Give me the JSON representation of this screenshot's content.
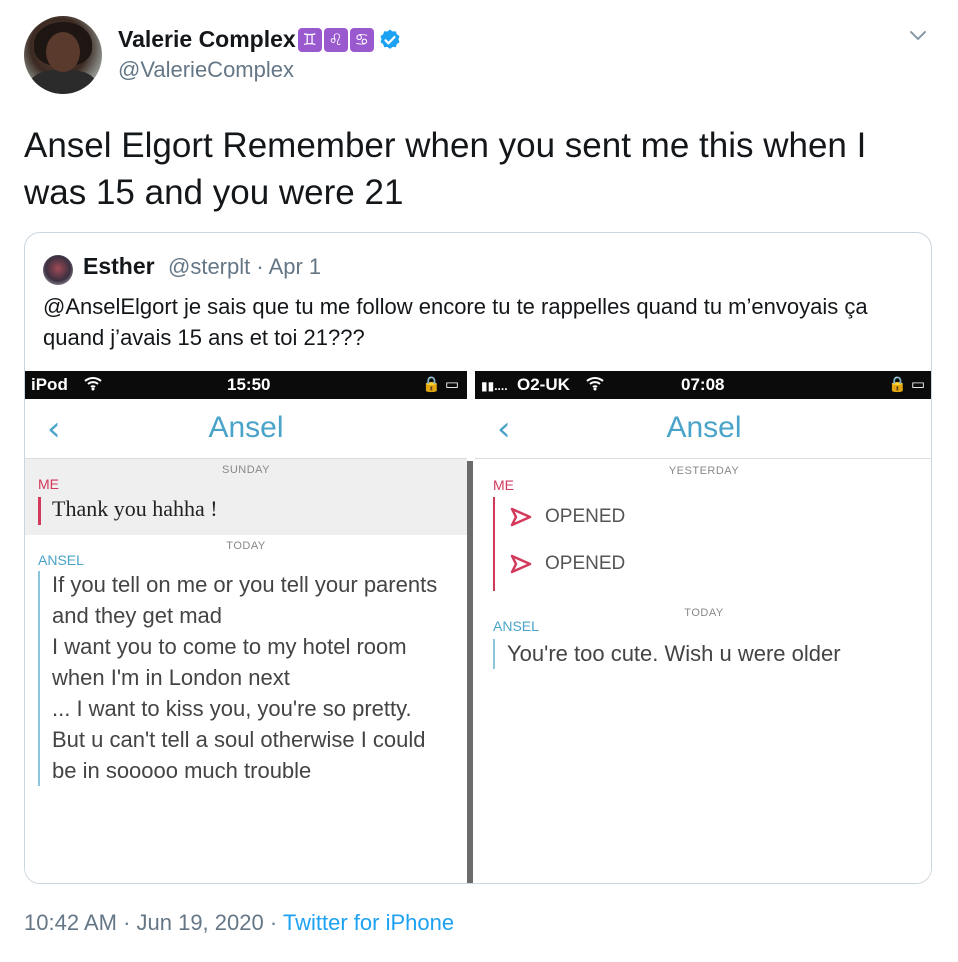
{
  "author": {
    "display_name": "Valerie Complex",
    "zodiac_icons": [
      "♊",
      "♌",
      "♋"
    ],
    "handle": "@ValerieComplex",
    "verified_icon": "verified-badge-icon"
  },
  "tweet": {
    "text": "Ansel Elgort Remember when you sent me this when I was 15 and you were 21"
  },
  "quote": {
    "name": "Esther",
    "meta": "@sterplt · Apr 1",
    "text": "@AnselElgort je sais que tu me follow encore tu te rappelles quand tu m’envoyais ça quand j’avais 15 ans et toi 21???",
    "screens": {
      "left": {
        "status_left": "iPod",
        "time": "15:50",
        "title": "Ansel",
        "day1": "SUNDAY",
        "me_label": "ME",
        "me_message": "Thank you hahha !",
        "day2": "TODAY",
        "ansel_label": "ANSEL",
        "ansel_lines": [
          "If you tell on me or you tell your parents",
          "and they get mad",
          "I want you to come to my hotel room",
          "when I'm in London next",
          "... I want to kiss you, you're so pretty.",
          "But u can't tell a soul otherwise I could",
          "be in sooooo much trouble"
        ]
      },
      "right": {
        "carrier": "O2-UK",
        "time": "07:08",
        "title": "Ansel",
        "day1": "YESTERDAY",
        "me_label": "ME",
        "opened1": "OPENED",
        "opened2": "OPENED",
        "day2": "TODAY",
        "ansel_label": "ANSEL",
        "ansel_message": "You're too cute. Wish u were older"
      }
    }
  },
  "footer": {
    "time": "10:42 AM · Jun 19, 2020 · ",
    "source": "Twitter for iPhone"
  }
}
